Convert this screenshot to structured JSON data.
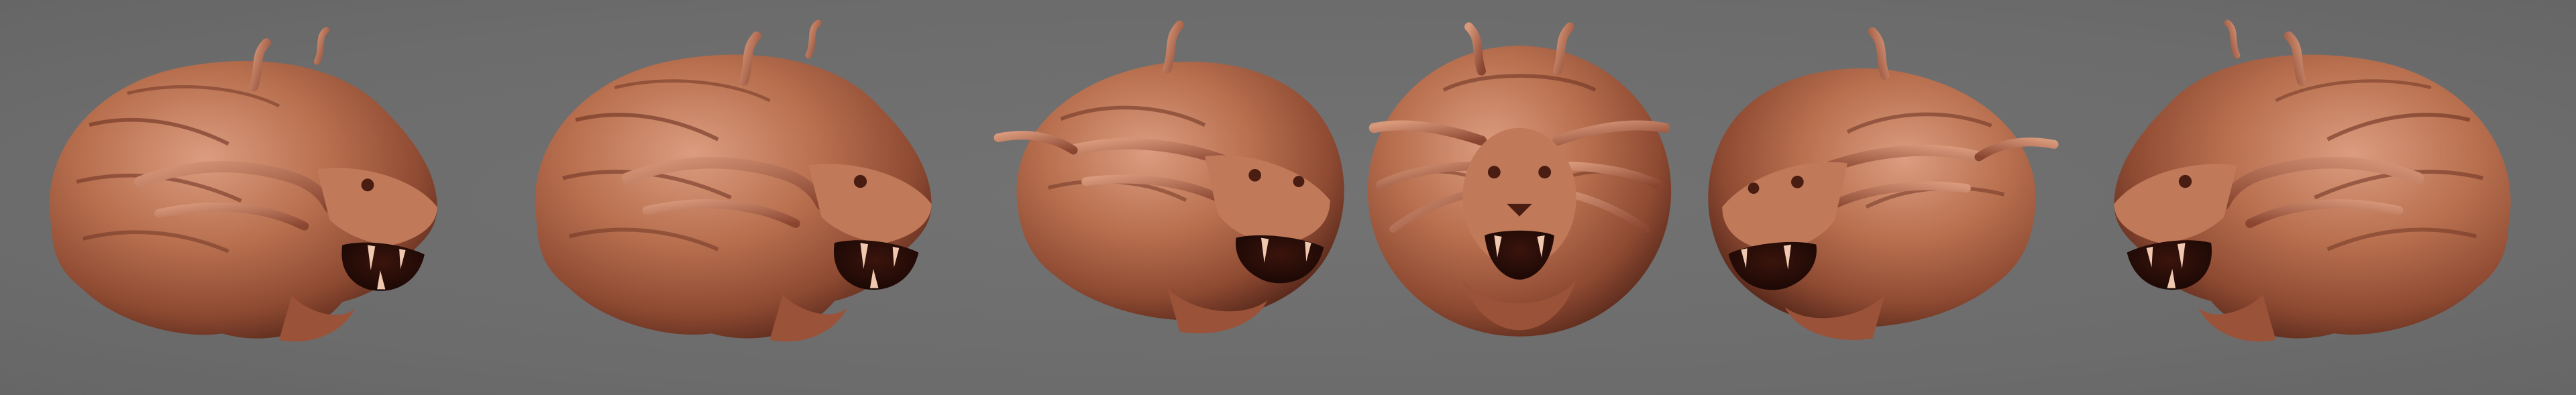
{
  "scene": {
    "background_color": "#6f6f6f",
    "material_color": "#b36a4f",
    "material_shadow": "#5a2a1c",
    "material_highlight": "#e0a285",
    "views": [
      {
        "name": "left-three-quarter-profile-view",
        "facing": "right"
      },
      {
        "name": "right-side-profile-view",
        "facing": "right"
      },
      {
        "name": "front-three-quarter-right-view",
        "facing": "right"
      },
      {
        "name": "front-view",
        "facing": "front"
      },
      {
        "name": "front-three-quarter-left-view",
        "facing": "left"
      },
      {
        "name": "left-side-profile-view",
        "facing": "left"
      }
    ]
  }
}
